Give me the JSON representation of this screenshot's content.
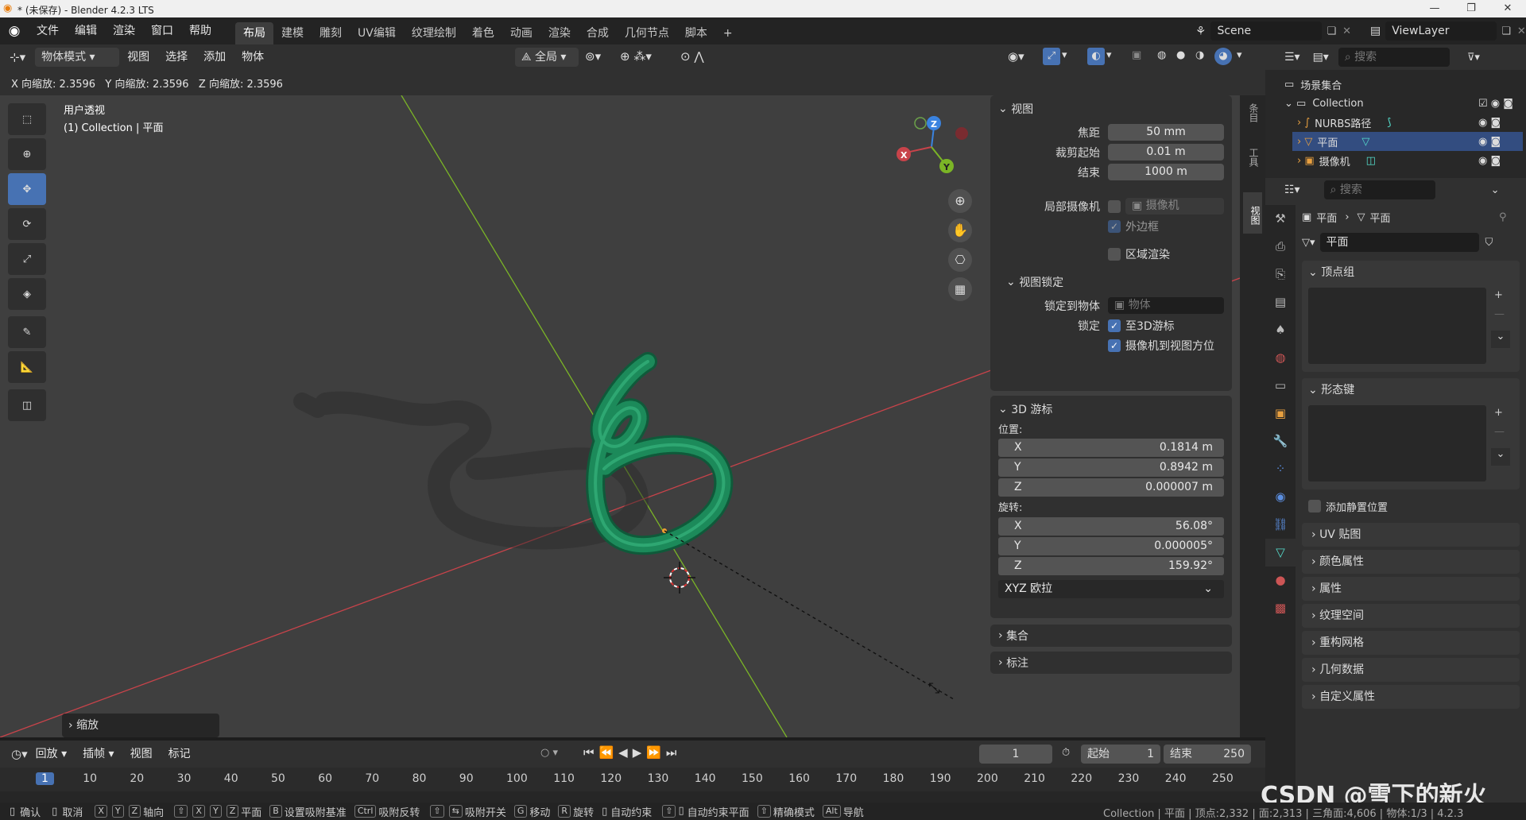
{
  "titlebar": {
    "title": "* (未保存) - Blender 4.2.3 LTS"
  },
  "menus": [
    "文件",
    "编辑",
    "渲染",
    "窗口",
    "帮助"
  ],
  "workspaces": [
    "布局",
    "建模",
    "雕刻",
    "UV编辑",
    "纹理绘制",
    "着色",
    "动画",
    "渲染",
    "合成",
    "几何节点",
    "脚本"
  ],
  "active_workspace": "布局",
  "scene": {
    "label": "Scene",
    "viewlayer": "ViewLayer"
  },
  "vpheader": {
    "mode": "物体模式",
    "items": [
      "视图",
      "选择",
      "添加",
      "物体"
    ],
    "orientation": "全局"
  },
  "statusline": {
    "text": "X 向缩放: 2.3596   Y 向缩放: 2.3596   Z 向缩放: 2.3596"
  },
  "viewport": {
    "view_name": "用户透视",
    "collection_info": "(1) Collection | 平面",
    "op_panel": "缩放"
  },
  "npanel": {
    "view": {
      "title": "视图",
      "focal_label": "焦距",
      "focal": "50 mm",
      "clip_start_label": "裁剪起始",
      "clip_start": "0.01 m",
      "clip_end_label": "结束",
      "clip_end": "1000 m",
      "local_cam_label": "局部摄像机",
      "local_cam": "摄像机",
      "border_label": "外边框",
      "region_render_label": "区域渲染"
    },
    "view_lock": {
      "title": "视图锁定",
      "lock_obj_label": "锁定到物体",
      "lock_obj_placeholder": "物体",
      "lock_label": "锁定",
      "lock_cursor": "至3D游标",
      "cam_to_view": "摄像机到视图方位"
    },
    "cursor": {
      "title": "3D 游标",
      "location_label": "位置:",
      "x": "0.1814 m",
      "y": "0.8942 m",
      "z": "0.000007 m",
      "rotation_label": "旋转:",
      "rx": "56.08°",
      "ry": "0.000005°",
      "rz": "159.92°",
      "mode": "XYZ 欧拉"
    },
    "collection": "集合",
    "annotation": "标注"
  },
  "sidetabs": [
    "条目",
    "工具",
    "视图"
  ],
  "timeline": {
    "menu": [
      "回放",
      "插帧",
      "视图",
      "标记"
    ],
    "current_frame": "1",
    "start_label": "起始",
    "start": "1",
    "end_label": "结束",
    "end": "250",
    "ticks": [
      "1",
      "10",
      "20",
      "30",
      "40",
      "50",
      "60",
      "70",
      "80",
      "90",
      "100",
      "110",
      "120",
      "130",
      "140",
      "150",
      "160",
      "170",
      "180",
      "190",
      "200",
      "210",
      "220",
      "230",
      "240",
      "250"
    ]
  },
  "outliner": {
    "search_placeholder": "搜索",
    "scene_collection": "场景集合",
    "collection": "Collection",
    "items": [
      "NURBS路径",
      "平面",
      "摄像机"
    ]
  },
  "properties": {
    "search_placeholder": "搜索",
    "breadcrumb_obj": "平面",
    "breadcrumb_data": "平面",
    "mesh_name": "平面",
    "vertex_groups": "顶点组",
    "shape_keys": "形态键",
    "add_rest_pos": "添加静置位置",
    "panels": [
      "UV 贴图",
      "颜色属性",
      "属性",
      "纹理空间",
      "重构网格",
      "几何数据",
      "自定义属性"
    ]
  },
  "statusbar": {
    "items": [
      "确认",
      "取消",
      "轴向",
      "平面",
      "设置吸附基准",
      "吸附反转",
      "吸附开关",
      "移动",
      "旋转",
      "自动约束",
      "自动约束平面",
      "精确模式",
      "导航"
    ],
    "right": "Collection | 平面 | 顶点:2,332 | 面:2,313 | 三角面:4,606 | 物体:1/3 | 4.2.3"
  },
  "watermark": "CSDN @雪下的新火",
  "colors": {
    "accent": "#4772b3",
    "axis_x": "#c8434a",
    "axis_y": "#7bb526",
    "axis_z": "#3a83e0",
    "knot": "#1c8a5a"
  }
}
